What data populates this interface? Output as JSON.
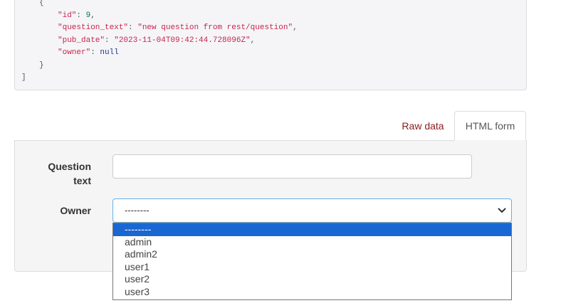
{
  "json_response": {
    "lines": [
      {
        "indent": 1,
        "parts": [
          {
            "t": "punct",
            "v": "{"
          }
        ]
      },
      {
        "indent": 2,
        "parts": [
          {
            "t": "key",
            "v": "\"id\""
          },
          {
            "t": "punct",
            "v": ": "
          },
          {
            "t": "num",
            "v": "9"
          },
          {
            "t": "punct",
            "v": ","
          }
        ]
      },
      {
        "indent": 2,
        "parts": [
          {
            "t": "key",
            "v": "\"question_text\""
          },
          {
            "t": "punct",
            "v": ": "
          },
          {
            "t": "str",
            "v": "\"new question from rest/question\""
          },
          {
            "t": "punct",
            "v": ","
          }
        ]
      },
      {
        "indent": 2,
        "parts": [
          {
            "t": "key",
            "v": "\"pub_date\""
          },
          {
            "t": "punct",
            "v": ": "
          },
          {
            "t": "str",
            "v": "\"2023-11-04T09:42:44.728096Z\""
          },
          {
            "t": "punct",
            "v": ","
          }
        ]
      },
      {
        "indent": 2,
        "parts": [
          {
            "t": "key",
            "v": "\"owner\""
          },
          {
            "t": "punct",
            "v": ": "
          },
          {
            "t": "null",
            "v": "null"
          }
        ]
      },
      {
        "indent": 1,
        "parts": [
          {
            "t": "punct",
            "v": "}"
          }
        ]
      },
      {
        "indent": 0,
        "parts": [
          {
            "t": "punct",
            "v": "]"
          }
        ]
      }
    ]
  },
  "tabs": {
    "raw_data_label": "Raw data",
    "html_form_label": "HTML form"
  },
  "form": {
    "question_text_label": "Question text",
    "question_text_value": "",
    "owner_label": "Owner",
    "owner_selected": "--------",
    "owner_options": [
      "--------",
      "admin",
      "admin2",
      "user1",
      "user2",
      "user3"
    ]
  },
  "colors": {
    "json_key": "#c7254e",
    "json_number": "#007a3d",
    "json_null": "#1a3a8a",
    "tab_link": "#8b1a1a",
    "select_focus_border": "#66afe9",
    "dropdown_highlight": "#1967d2"
  },
  "icons": {
    "select_arrow": "chevron-down-icon"
  }
}
